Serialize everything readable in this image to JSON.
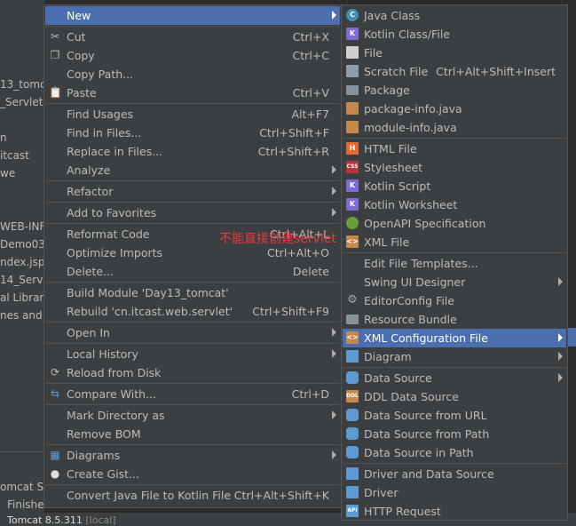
{
  "background": {
    "left_lines": [
      "",
      "13_tomc",
      "_Servlet",
      "",
      "n",
      "itcast",
      "we",
      "",
      "",
      "WEB-INF",
      "Demo03",
      "ndex.jsp",
      "14_Servl",
      "al Librari",
      "nes and C"
    ],
    "tab_label": "omcat Se",
    "finished_label": "Finishe",
    "status": {
      "server": "Tomcat 8.5.311",
      "mode": "[local]"
    }
  },
  "overlay_text": "不能直接创建servlet",
  "context_menu": [
    {
      "label": "New",
      "shortcut": "",
      "arrow": true,
      "selected": true,
      "icon": ""
    },
    {
      "sep": true
    },
    {
      "label": "Cut",
      "shortcut": "Ctrl+X",
      "icon": "scissors-icon"
    },
    {
      "label": "Copy",
      "shortcut": "Ctrl+C",
      "icon": "copy-icon"
    },
    {
      "label": "Copy Path...",
      "shortcut": ""
    },
    {
      "label": "Paste",
      "shortcut": "Ctrl+V",
      "icon": "paste-icon"
    },
    {
      "sep": true
    },
    {
      "label": "Find Usages",
      "shortcut": "Alt+F7"
    },
    {
      "label": "Find in Files...",
      "shortcut": "Ctrl+Shift+F"
    },
    {
      "label": "Replace in Files...",
      "shortcut": "Ctrl+Shift+R"
    },
    {
      "label": "Analyze",
      "shortcut": "",
      "arrow": true
    },
    {
      "sep": true
    },
    {
      "label": "Refactor",
      "shortcut": "",
      "arrow": true
    },
    {
      "sep": true
    },
    {
      "label": "Add to Favorites",
      "shortcut": "",
      "arrow": true
    },
    {
      "sep": true
    },
    {
      "label": "Reformat Code",
      "shortcut": "Ctrl+Alt+L"
    },
    {
      "label": "Optimize Imports",
      "shortcut": "Ctrl+Alt+O"
    },
    {
      "label": "Delete...",
      "shortcut": "Delete"
    },
    {
      "sep": true
    },
    {
      "label": "Build Module 'Day13_tomcat'",
      "shortcut": ""
    },
    {
      "label": "Rebuild 'cn.itcast.web.servlet'",
      "shortcut": "Ctrl+Shift+F9"
    },
    {
      "sep": true
    },
    {
      "label": "Open In",
      "shortcut": "",
      "arrow": true
    },
    {
      "sep": true
    },
    {
      "label": "Local History",
      "shortcut": "",
      "arrow": true
    },
    {
      "label": "Reload from Disk",
      "shortcut": "",
      "icon": "reload-icon"
    },
    {
      "sep": true
    },
    {
      "label": "Compare With...",
      "shortcut": "Ctrl+D",
      "icon": "compare-icon"
    },
    {
      "sep": true
    },
    {
      "label": "Mark Directory as",
      "shortcut": "",
      "arrow": true
    },
    {
      "label": "Remove BOM",
      "shortcut": ""
    },
    {
      "sep": true
    },
    {
      "label": "Diagrams",
      "shortcut": "",
      "arrow": true,
      "icon": "diagram-icon"
    },
    {
      "label": "Create Gist...",
      "shortcut": "",
      "icon": "github-icon"
    },
    {
      "sep": true
    },
    {
      "label": "Convert Java File to Kotlin File",
      "shortcut": "Ctrl+Alt+Shift+K"
    }
  ],
  "new_submenu": [
    {
      "label": "Java Class",
      "shortcut": "",
      "icon": "java-class-icon",
      "color": "#3d8fb4",
      "glyph": "C",
      "kind": "circle"
    },
    {
      "label": "Kotlin Class/File",
      "shortcut": "",
      "icon": "kotlin-icon",
      "color": "#7f6bd1",
      "glyph": "K",
      "kind": "file"
    },
    {
      "label": "File",
      "shortcut": "",
      "icon": "file-icon",
      "color": "#cfcfcf",
      "glyph": "",
      "kind": "file"
    },
    {
      "label": "Scratch File",
      "shortcut": "Ctrl+Alt+Shift+Insert",
      "icon": "scratch-file-icon",
      "color": "#8b9da6",
      "glyph": "",
      "kind": "file"
    },
    {
      "label": "Package",
      "shortcut": "",
      "icon": "package-icon",
      "color": "#87939a",
      "glyph": "",
      "kind": "folder"
    },
    {
      "label": "package-info.java",
      "shortcut": "",
      "icon": "java-file-icon",
      "color": "#c4884c",
      "glyph": "",
      "kind": "file"
    },
    {
      "label": "module-info.java",
      "shortcut": "",
      "icon": "java-file-icon",
      "color": "#c4884c",
      "glyph": "",
      "kind": "file"
    },
    {
      "sep": true
    },
    {
      "label": "HTML File",
      "shortcut": "",
      "icon": "html-file-icon",
      "color": "#e6682d",
      "glyph": "H",
      "kind": "file"
    },
    {
      "label": "Stylesheet",
      "shortcut": "",
      "icon": "css-file-icon",
      "color": "#b53838",
      "glyph": "CSS",
      "kind": "file"
    },
    {
      "label": "Kotlin Script",
      "shortcut": "",
      "icon": "kotlin-script-icon",
      "color": "#7f6bd1",
      "glyph": "K",
      "kind": "file"
    },
    {
      "label": "Kotlin Worksheet",
      "shortcut": "",
      "icon": "kotlin-worksheet-icon",
      "color": "#7f6bd1",
      "glyph": "K",
      "kind": "file"
    },
    {
      "label": "OpenAPI Specification",
      "shortcut": "",
      "icon": "openapi-icon",
      "color": "#6a9e3b",
      "glyph": "",
      "kind": "circle"
    },
    {
      "label": "XML File",
      "shortcut": "",
      "icon": "xml-file-icon",
      "color": "#c4884c",
      "glyph": "<>",
      "kind": "file"
    },
    {
      "sep": true
    },
    {
      "label": "Edit File Templates...",
      "shortcut": "",
      "icon": ""
    },
    {
      "label": "Swing UI Designer",
      "shortcut": "",
      "arrow": true,
      "icon": ""
    },
    {
      "label": "EditorConfig File",
      "shortcut": "",
      "icon": "gear-icon",
      "color": "",
      "glyph": "⚙",
      "kind": "gear"
    },
    {
      "label": "Resource Bundle",
      "shortcut": "",
      "icon": "resource-bundle-icon",
      "color": "#87939a",
      "glyph": "",
      "kind": "folder"
    },
    {
      "label": "XML Configuration File",
      "shortcut": "",
      "arrow": true,
      "selected": true,
      "icon": "xml-config-icon",
      "color": "#c4884c",
      "glyph": "<>",
      "kind": "file"
    },
    {
      "label": "Diagram",
      "shortcut": "",
      "arrow": true,
      "icon": "diagram-icon",
      "color": "#5a9bd1",
      "glyph": "",
      "kind": "file"
    },
    {
      "sep": true
    },
    {
      "label": "Data Source",
      "shortcut": "",
      "arrow": true,
      "icon": "data-source-icon",
      "color": "#5a9bd1",
      "glyph": "",
      "kind": "db"
    },
    {
      "label": "DDL Data Source",
      "shortcut": "",
      "icon": "ddl-icon",
      "color": "#c4884c",
      "glyph": "DDL",
      "kind": "file"
    },
    {
      "label": "Data Source from URL",
      "shortcut": "",
      "icon": "data-source-url-icon",
      "color": "#5a9bd1",
      "glyph": "",
      "kind": "db"
    },
    {
      "label": "Data Source from Path",
      "shortcut": "",
      "icon": "data-source-path-icon",
      "color": "#5a9bd1",
      "glyph": "",
      "kind": "db"
    },
    {
      "label": "Data Source in Path",
      "shortcut": "",
      "icon": "data-source-in-path-icon",
      "color": "#5a9bd1",
      "glyph": "",
      "kind": "db"
    },
    {
      "sep": true
    },
    {
      "label": "Driver and Data Source",
      "shortcut": "",
      "icon": "driver-data-source-icon",
      "color": "#5a9bd1",
      "glyph": "",
      "kind": "file"
    },
    {
      "label": "Driver",
      "shortcut": "",
      "icon": "driver-icon",
      "color": "#5a9bd1",
      "glyph": "",
      "kind": "file"
    },
    {
      "label": "HTTP Request",
      "shortcut": "",
      "icon": "http-request-icon",
      "color": "#5a9bd1",
      "glyph": "API",
      "kind": "file"
    }
  ]
}
